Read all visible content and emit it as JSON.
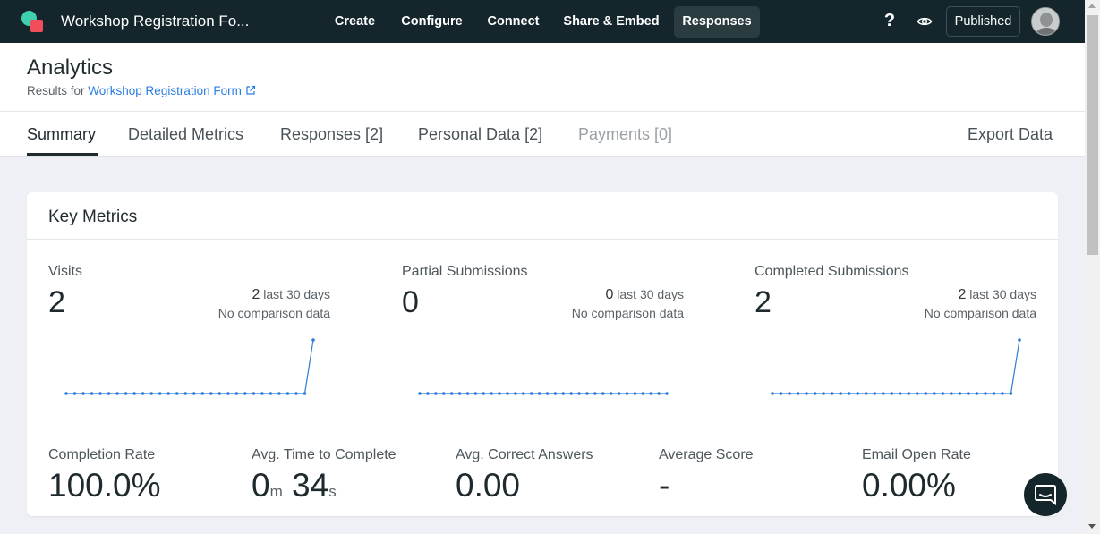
{
  "app": {
    "title": "Workshop Registration Fo..."
  },
  "nav": [
    {
      "label": "Create"
    },
    {
      "label": "Configure"
    },
    {
      "label": "Connect"
    },
    {
      "label": "Share & Embed"
    },
    {
      "label": "Responses",
      "active": true
    }
  ],
  "topbar": {
    "help_glyph": "?",
    "published_label": "Published"
  },
  "page": {
    "title": "Analytics",
    "results_prefix": "Results for ",
    "results_link": "Workshop Registration Form"
  },
  "tabs": [
    {
      "label": "Summary",
      "active": true
    },
    {
      "label": "Detailed Metrics"
    },
    {
      "label": "Responses [2]"
    },
    {
      "label": "Personal Data [2]"
    },
    {
      "label": "Payments [0]",
      "disabled": true
    }
  ],
  "export_label": "Export Data",
  "key_metrics": {
    "title": "Key Metrics",
    "metrics": [
      {
        "label": "Visits",
        "value": "2",
        "last_30": "2",
        "last_30_suffix": " last 30 days",
        "comparison": "No comparison data",
        "spark": [
          0,
          0,
          0,
          0,
          0,
          0,
          0,
          0,
          0,
          0,
          0,
          0,
          0,
          0,
          0,
          0,
          0,
          0,
          0,
          0,
          0,
          0,
          0,
          0,
          0,
          0,
          0,
          0,
          0,
          1
        ]
      },
      {
        "label": "Partial Submissions",
        "value": "0",
        "last_30": "0",
        "last_30_suffix": " last 30 days",
        "comparison": "No comparison data",
        "spark": [
          0,
          0,
          0,
          0,
          0,
          0,
          0,
          0,
          0,
          0,
          0,
          0,
          0,
          0,
          0,
          0,
          0,
          0,
          0,
          0,
          0,
          0,
          0,
          0,
          0,
          0,
          0,
          0,
          0,
          0,
          0,
          0
        ]
      },
      {
        "label": "Completed Submissions",
        "value": "2",
        "last_30": "2",
        "last_30_suffix": " last 30 days",
        "comparison": "No comparison data",
        "spark": [
          0,
          0,
          0,
          0,
          0,
          0,
          0,
          0,
          0,
          0,
          0,
          0,
          0,
          0,
          0,
          0,
          0,
          0,
          0,
          0,
          0,
          0,
          0,
          0,
          0,
          0,
          0,
          0,
          0,
          1
        ]
      }
    ],
    "stats": [
      {
        "label": "Completion Rate",
        "value": "100.0%"
      },
      {
        "label": "Avg. Time to Complete",
        "minutes": "0",
        "minutes_unit": "m",
        "seconds": "34",
        "seconds_unit": "s"
      },
      {
        "label": "Avg. Correct Answers",
        "value": "0.00"
      },
      {
        "label": "Average Score",
        "value": "-"
      },
      {
        "label": "Email Open Rate",
        "value": "0.00%"
      }
    ]
  },
  "colors": {
    "topbar": "#14262b",
    "accent_link": "#2a7de1",
    "spark_line": "#2f7bd8",
    "arrow": "#e0201d"
  },
  "icons": {
    "logo": "typeform-style-logo",
    "help": "help-icon",
    "preview": "eye-icon",
    "external": "external-link-icon",
    "chat": "chat-icon"
  }
}
